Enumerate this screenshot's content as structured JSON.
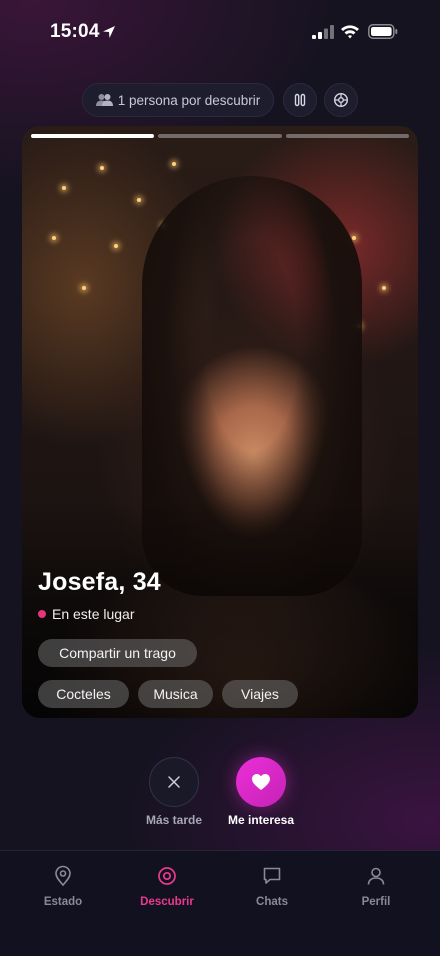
{
  "status_bar": {
    "time": "15:04"
  },
  "header": {
    "discover_count_label": "1 persona por descubrir"
  },
  "profile": {
    "name_age": "Josefa, 34",
    "presence": "En este lugar",
    "intent": "Compartir un trago",
    "interests": [
      "Cocteles",
      "Musica",
      "Viajes"
    ],
    "photo_count": 3,
    "current_photo": 1
  },
  "actions": {
    "later_label": "Más tarde",
    "like_label": "Me interesa"
  },
  "tabs": [
    {
      "label": "Estado",
      "icon": "map-pin-icon"
    },
    {
      "label": "Descubrir",
      "icon": "target-icon",
      "active": true
    },
    {
      "label": "Chats",
      "icon": "chat-bubble-icon"
    },
    {
      "label": "Perfil",
      "icon": "user-icon"
    }
  ],
  "colors": {
    "accent": "#ea3a8f",
    "like_gradient_start": "#ec2fd8",
    "presence_dot": "#e8337d",
    "background": "#14131f"
  }
}
